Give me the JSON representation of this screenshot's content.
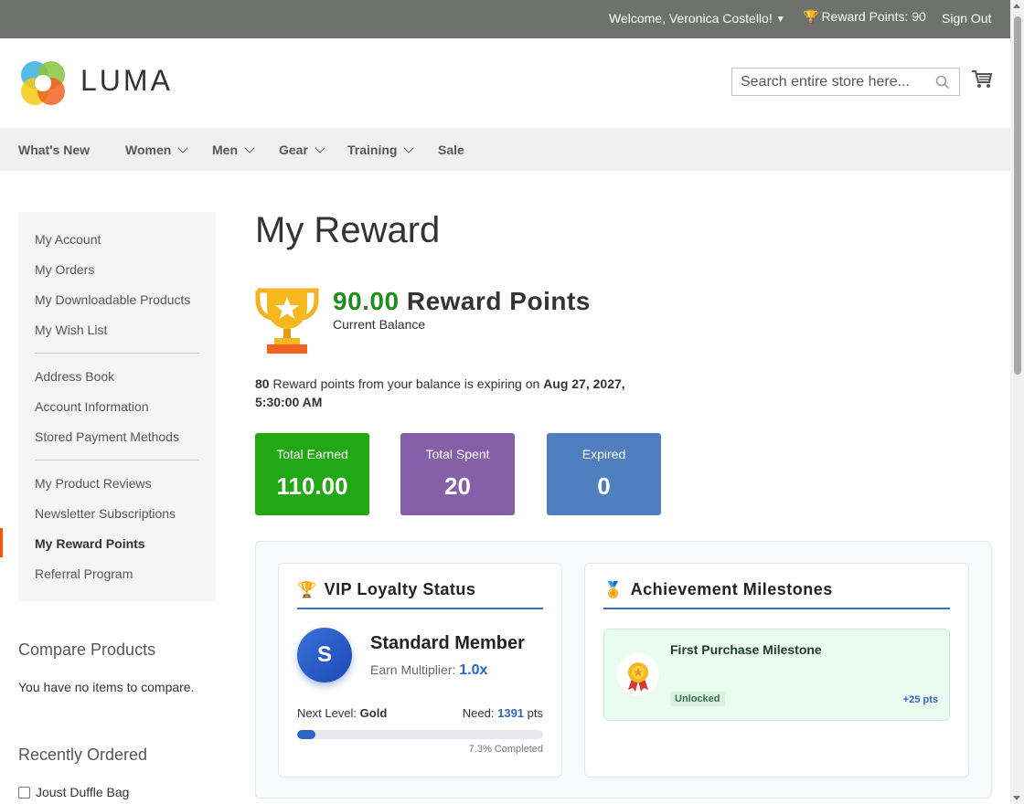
{
  "topbar": {
    "welcome": "Welcome, Veronica Costello!",
    "reward_points": "Reward Points: 90",
    "sign_out": "Sign Out"
  },
  "header": {
    "logo_text": "LUMA",
    "search_placeholder": "Search entire store here...",
    "cart_icon": "cart-icon"
  },
  "nav": {
    "items": [
      {
        "label": "What's New",
        "has_dropdown": false
      },
      {
        "label": "Women",
        "has_dropdown": true
      },
      {
        "label": "Men",
        "has_dropdown": true
      },
      {
        "label": "Gear",
        "has_dropdown": true
      },
      {
        "label": "Training",
        "has_dropdown": true
      },
      {
        "label": "Sale",
        "has_dropdown": false
      }
    ]
  },
  "sidebar": {
    "items": [
      {
        "label": "My Account"
      },
      {
        "label": "My Orders"
      },
      {
        "label": "My Downloadable Products"
      },
      {
        "label": "My Wish List"
      },
      {
        "label": "Address Book"
      },
      {
        "label": "Account Information"
      },
      {
        "label": "Stored Payment Methods"
      },
      {
        "label": "My Product Reviews"
      },
      {
        "label": "Newsletter Subscriptions"
      },
      {
        "label": "My Reward Points",
        "active": true
      },
      {
        "label": "Referral Program"
      }
    ],
    "compare_title": "Compare Products",
    "compare_text": "You have no items to compare.",
    "recent_title": "Recently Ordered",
    "recent_item": "Joust Duffle Bag"
  },
  "main": {
    "page_title": "My Reward",
    "balance_value": "90.00",
    "balance_label": "Reward Points",
    "balance_sub": "Current Balance",
    "expiring_points": "80",
    "expiring_text": " Reward points from your balance is expiring on ",
    "expiring_date": "Aug 27, 2027, 5:30:00 AM",
    "stats": [
      {
        "label": "Total Earned",
        "value": "110.00",
        "color": "#22a814"
      },
      {
        "label": "Total Spent",
        "value": "20",
        "color": "#8560a8"
      },
      {
        "label": "Expired",
        "value": "0",
        "color": "#4f7fbe"
      }
    ]
  },
  "vip": {
    "title": "VIP Loyalty Status",
    "avatar_letter": "S",
    "tier": "Standard Member",
    "multiplier_label": "Earn Multiplier: ",
    "multiplier_value": "1.0x",
    "next_level_label": "Next Level: ",
    "next_level_value": "Gold",
    "need_label": "Need: ",
    "need_value": "1391",
    "need_unit": " pts",
    "progress_percent": 7.3,
    "completed_text": "7.3% Completed"
  },
  "milestones": {
    "title": "Achievement Milestones",
    "items": [
      {
        "title": "First Purchase Milestone",
        "status": "Unlocked",
        "points": "+25 pts"
      }
    ]
  },
  "colors": {
    "accent_orange": "#ff5501",
    "balance_green": "#1d8f1d",
    "progress_blue": "#2a66c5"
  }
}
